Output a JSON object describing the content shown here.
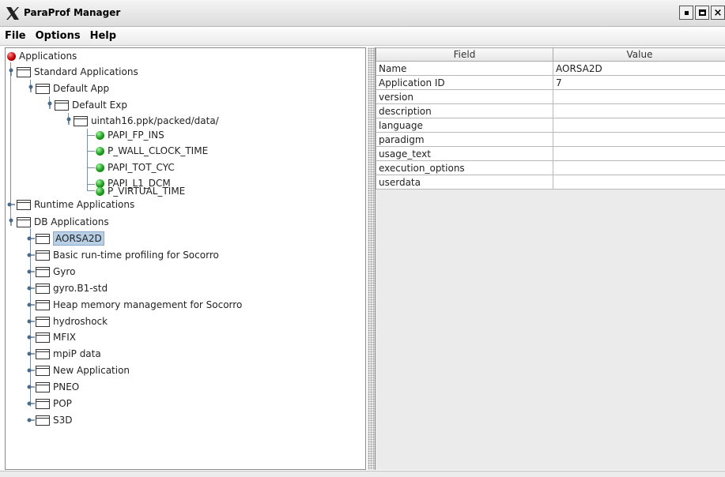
{
  "window": {
    "title": "ParaProf Manager"
  },
  "menu": [
    "File",
    "Options",
    "Help"
  ],
  "tree": {
    "root": "Applications",
    "standard": {
      "label": "Standard Applications",
      "app": "Default App",
      "exp": "Default Exp",
      "trial": "uintah16.ppk/packed/data/",
      "metrics": [
        "PAPI_FP_INS",
        "P_WALL_CLOCK_TIME",
        "PAPI_TOT_CYC",
        "PAPI_L1_DCM",
        "P_VIRTUAL_TIME"
      ]
    },
    "runtime": "Runtime Applications",
    "db": {
      "label": "DB Applications",
      "apps": [
        "AORSA2D",
        "Basic run-time profiling for Socorro",
        "Gyro",
        "gyro.B1-std",
        "Heap memory management for Socorro",
        "hydroshock",
        "MFIX",
        "mpiP data",
        "New Application",
        "PNEO",
        "POP",
        "S3D"
      ],
      "selected": "AORSA2D"
    }
  },
  "table": {
    "headers": [
      "Field",
      "Value"
    ],
    "rows": [
      [
        "Name",
        "AORSA2D"
      ],
      [
        "Application ID",
        "7"
      ],
      [
        "version",
        ""
      ],
      [
        "description",
        ""
      ],
      [
        "language",
        ""
      ],
      [
        "paradigm",
        ""
      ],
      [
        "usage_text",
        ""
      ],
      [
        "execution_options",
        ""
      ],
      [
        "userdata",
        ""
      ]
    ]
  },
  "colors": {
    "selection": "#b8cfe5",
    "metric_ball": "#1c9c1c",
    "root_ball": "#c40000"
  }
}
